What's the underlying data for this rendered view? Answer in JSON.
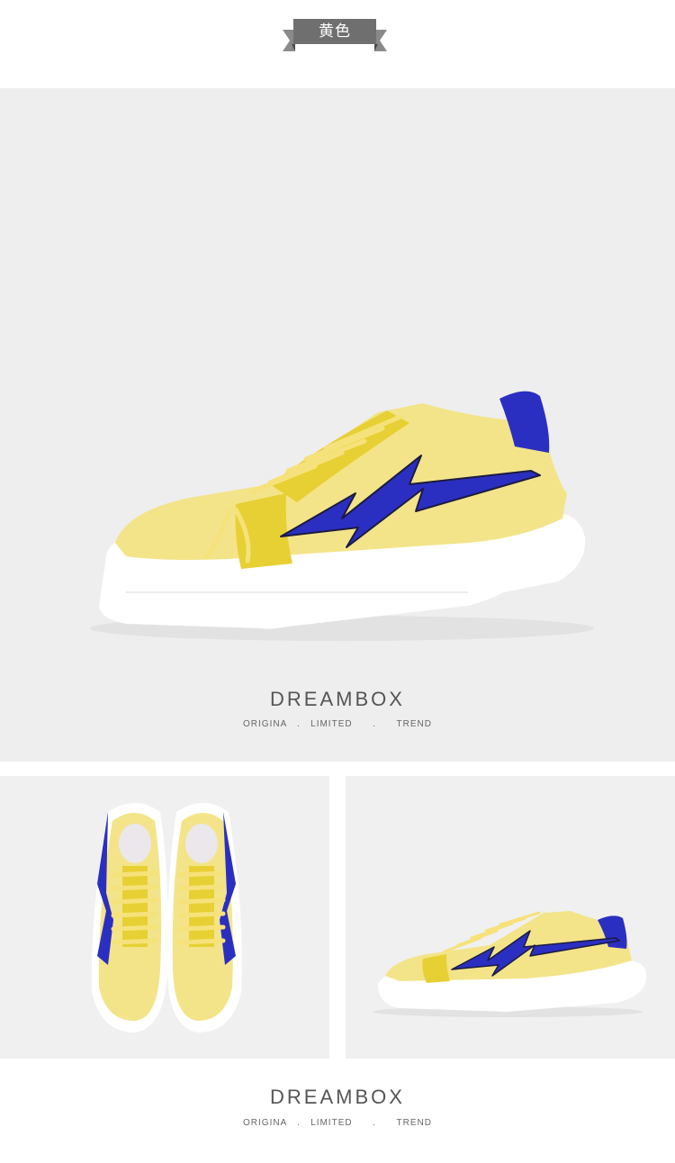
{
  "color_tag": {
    "label": "黄色"
  },
  "sections": [
    {
      "brand": "DREAMBOX",
      "tagline": "ORIGINA   .   LIMITED      .      TREND"
    },
    {
      "brand": "DREAMBOX",
      "tagline": "ORIGINA   .   LIMITED      .      TREND"
    }
  ],
  "colors": {
    "upper_yellow": "#f3e489",
    "suede_yellow": "#e7d034",
    "bolt_blue": "#2b2fc1",
    "sole_white": "#ffffff",
    "background": "#eeeeee",
    "ribbon_gray": "#6f6f6f"
  },
  "images": [
    {
      "name": "shoe-side-view",
      "desc": "yellow sneaker with blue lightning bolt, side view"
    },
    {
      "name": "shoe-top-view-pair",
      "desc": "pair of yellow sneakers from above"
    },
    {
      "name": "shoe-side-view-small",
      "desc": "yellow sneaker side view"
    }
  ]
}
